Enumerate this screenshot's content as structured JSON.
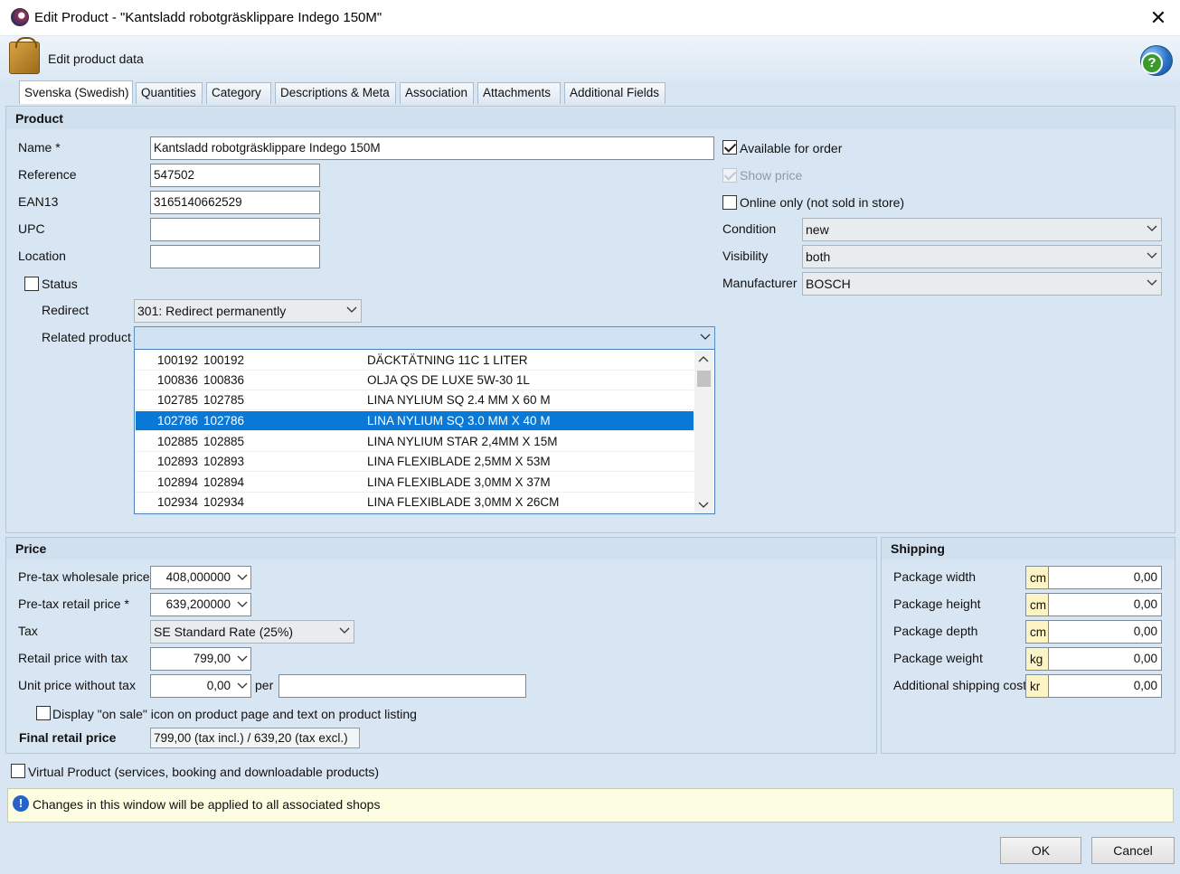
{
  "window": {
    "title": "Edit Product - \"Kantsladd robotgräsklippare Indego 150M\"",
    "close_glyph": "✕"
  },
  "header": {
    "text": "Edit product data",
    "help_glyph": "?"
  },
  "tabs": [
    "Svenska (Swedish)",
    "Quantities",
    "Category",
    "Descriptions & Meta",
    "Association",
    "Attachments",
    "Additional Fields"
  ],
  "product": {
    "section_title": "Product",
    "name_label": "Name *",
    "name_value": "Kantsladd robotgräsklippare Indego 150M",
    "reference_label": "Reference",
    "reference_value": "547502",
    "ean13_label": "EAN13",
    "ean13_value": "3165140662529",
    "upc_label": "UPC",
    "upc_value": "",
    "location_label": "Location",
    "location_value": "",
    "status_label": "Status",
    "status_checked": false,
    "redirect_label": "Redirect",
    "redirect_value": "301: Redirect permanently",
    "related_label": "Related product",
    "related_value": "",
    "available_label": "Available for order",
    "available_checked": true,
    "show_price_label": "Show price",
    "show_price_checked": true,
    "online_only_label": "Online only (not sold in store)",
    "online_only_checked": false,
    "condition_label": "Condition",
    "condition_value": "new",
    "visibility_label": "Visibility",
    "visibility_value": "both",
    "manufacturer_label": "Manufacturer",
    "manufacturer_value": "BOSCH"
  },
  "related_list": [
    {
      "id": "100192",
      "ref": "100192",
      "name": "DÄCKTÄTNING 11C 1 LITER",
      "selected": false
    },
    {
      "id": "100836",
      "ref": "100836",
      "name": "OLJA QS DE LUXE 5W-30 1L",
      "selected": false
    },
    {
      "id": "102785",
      "ref": "102785",
      "name": "LINA NYLIUM SQ 2.4 MM X 60 M",
      "selected": false
    },
    {
      "id": "102786",
      "ref": "102786",
      "name": "LINA NYLIUM SQ 3.0 MM X 40 M",
      "selected": true
    },
    {
      "id": "102885",
      "ref": "102885",
      "name": "LINA NYLIUM STAR 2,4MM X 15M",
      "selected": false
    },
    {
      "id": "102893",
      "ref": "102893",
      "name": "LINA FLEXIBLADE 2,5MM X 53M",
      "selected": false
    },
    {
      "id": "102894",
      "ref": "102894",
      "name": "LINA FLEXIBLADE 3,0MM X 37M",
      "selected": false
    },
    {
      "id": "102934",
      "ref": "102934",
      "name": "LINA FLEXIBLADE 3,0MM X 26CM",
      "selected": false
    }
  ],
  "price": {
    "section_title": "Price",
    "wholesale_label": "Pre-tax wholesale price",
    "wholesale_value": "408,000000",
    "retail_label": "Pre-tax retail price *",
    "retail_value": "639,200000",
    "tax_label": "Tax",
    "tax_value": "SE Standard Rate (25%)",
    "retail_tax_label": "Retail price with tax",
    "retail_tax_value": "799,00",
    "unit_price_label": "Unit price without tax",
    "unit_price_value": "0,00",
    "per_label": "per",
    "per_value": "",
    "on_sale_label": "Display \"on sale\" icon on product page and text on product listing",
    "on_sale_checked": false,
    "final_label": "Final retail price",
    "final_value": "799,00 (tax incl.) / 639,20 (tax excl.)"
  },
  "shipping": {
    "section_title": "Shipping",
    "rows": [
      {
        "label": "Package width",
        "unit": "cm",
        "value": "0,00"
      },
      {
        "label": "Package height",
        "unit": "cm",
        "value": "0,00"
      },
      {
        "label": "Package depth",
        "unit": "cm",
        "value": "0,00"
      },
      {
        "label": "Package weight",
        "unit": "kg",
        "value": "0,00"
      },
      {
        "label": "Additional shipping cost",
        "unit": "kr",
        "value": "0,00"
      }
    ]
  },
  "virtual_label": "Virtual Product (services, booking and downloadable products)",
  "virtual_checked": false,
  "info_text": "Changes in this window will be applied to all associated shops",
  "info_glyph": "!",
  "buttons": {
    "ok": "OK",
    "cancel": "Cancel"
  },
  "colors": {
    "selection": "#0a78d7",
    "panel": "#d8e6f3",
    "info_bg": "#fdfde2"
  }
}
